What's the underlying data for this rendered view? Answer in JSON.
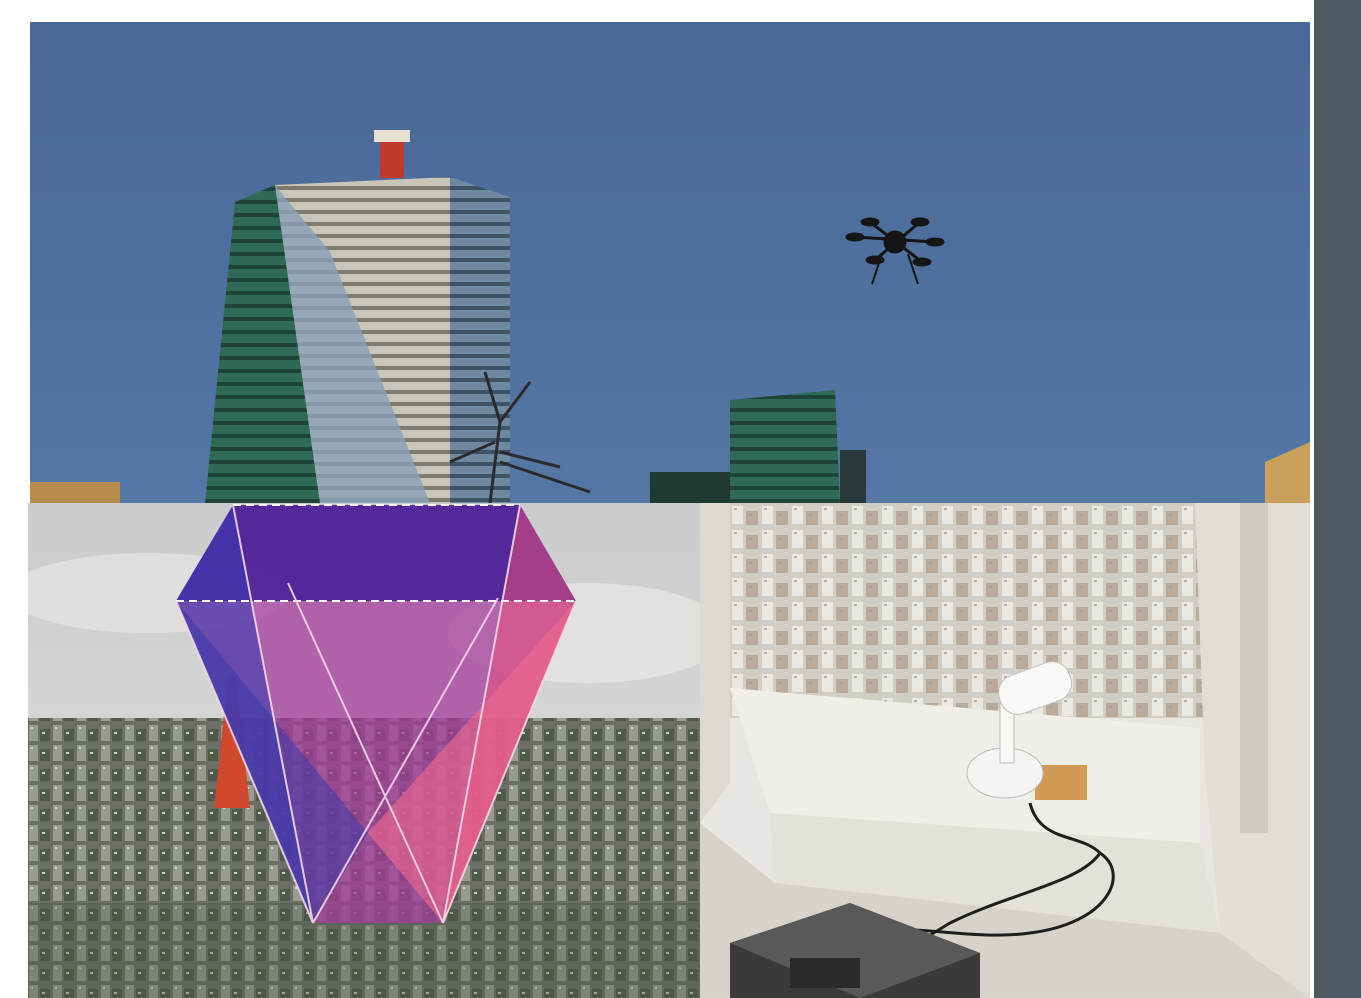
{
  "page": {
    "background": "#ffffff",
    "side_bar_color": "#4f5b64"
  },
  "photos": [
    {
      "name": "drone-over-city-photo",
      "subjects": [
        "office-tower",
        "drone",
        "sky"
      ]
    },
    {
      "name": "sensor-coverage-cone-photo",
      "subjects": [
        "city-skyline",
        "tokyo-tower",
        "coverage-cone-overlay"
      ]
    },
    {
      "name": "window-camera-photo",
      "subjects": [
        "security-camera",
        "window",
        "city-view",
        "recorder-box",
        "cables"
      ]
    }
  ],
  "colors": {
    "sky": "#4c6c99",
    "cone_purple": "#5a2a9c",
    "cone_pink": "#e05a8a",
    "cone_blue": "#4a4aa8"
  }
}
